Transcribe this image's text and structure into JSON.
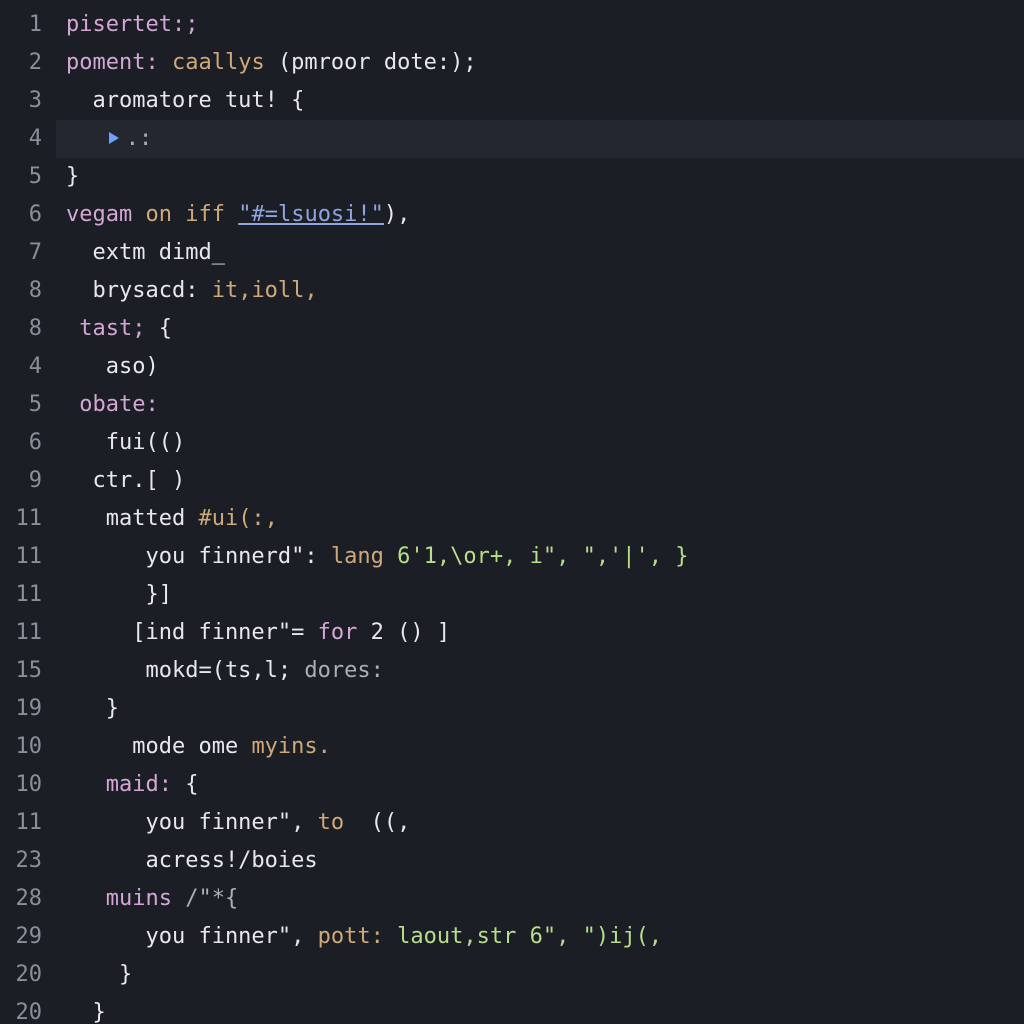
{
  "gutter": [
    "1",
    "2",
    "3",
    "4",
    "5",
    "6",
    "7",
    "8",
    "8",
    "4",
    "5",
    "6",
    "9",
    "11",
    "11",
    "11",
    "11",
    "15",
    "19",
    "10",
    "10",
    "11",
    "23",
    "28",
    "29",
    "20",
    "20"
  ],
  "lines": {
    "l1": {
      "a": "pisertet:;"
    },
    "l2": {
      "a": "poment:",
      "b": "caallys",
      "c": "(pmroor dote:);"
    },
    "l3": {
      "a": "  aromatore tut! {"
    },
    "l4": {
      "a": ".:"
    },
    "l5": {
      "a": "}"
    },
    "l6": {
      "a": "vegam",
      "b": "on iff",
      "c": "\"#=lsuosi!\"",
      "d": "),"
    },
    "l7": {
      "a": "  extm dimd_"
    },
    "l8": {
      "a": "  brysacd: ",
      "b": "it,ioll,"
    },
    "l9": {
      "a": "tast;",
      "b": " {"
    },
    "l10": {
      "a": "   aso)"
    },
    "l11": {
      "a": "obate:"
    },
    "l12": {
      "a": "   fui(()"
    },
    "l13": {
      "a": "  ctr.[ )"
    },
    "l14": {
      "a": "   matted ",
      "b": "#ui(:,"
    },
    "l15": {
      "a": "      you finnerd\": ",
      "b": "lang",
      "c": " 6'1,\\or+, i\", \",'|', }"
    },
    "l16": {
      "a": "      }]"
    },
    "l17": {
      "a": "     [ind finner\"= ",
      "b": "for",
      "c": " 2 () ]"
    },
    "l18": {
      "a": "      mokd=(ts,l; ",
      "b": "dores:"
    },
    "l19": {
      "a": "   }"
    },
    "l20": {
      "a": "     mode ome ",
      "b": "myins."
    },
    "l21": {
      "a": "   maid:",
      "b": " {"
    },
    "l22": {
      "a": "      you finner\", ",
      "b": "to",
      "c": "  ((,"
    },
    "l23": {
      "a": "      acress!/boies"
    },
    "l24": {
      "a": "   muins ",
      "b": "/\"*{"
    },
    "l25": {
      "a": "      you finner\", ",
      "b": "pott:",
      "c": " laout,str 6\", \")ij(,"
    },
    "l26": {
      "a": "    }"
    },
    "l27": {
      "a": "  }"
    }
  }
}
